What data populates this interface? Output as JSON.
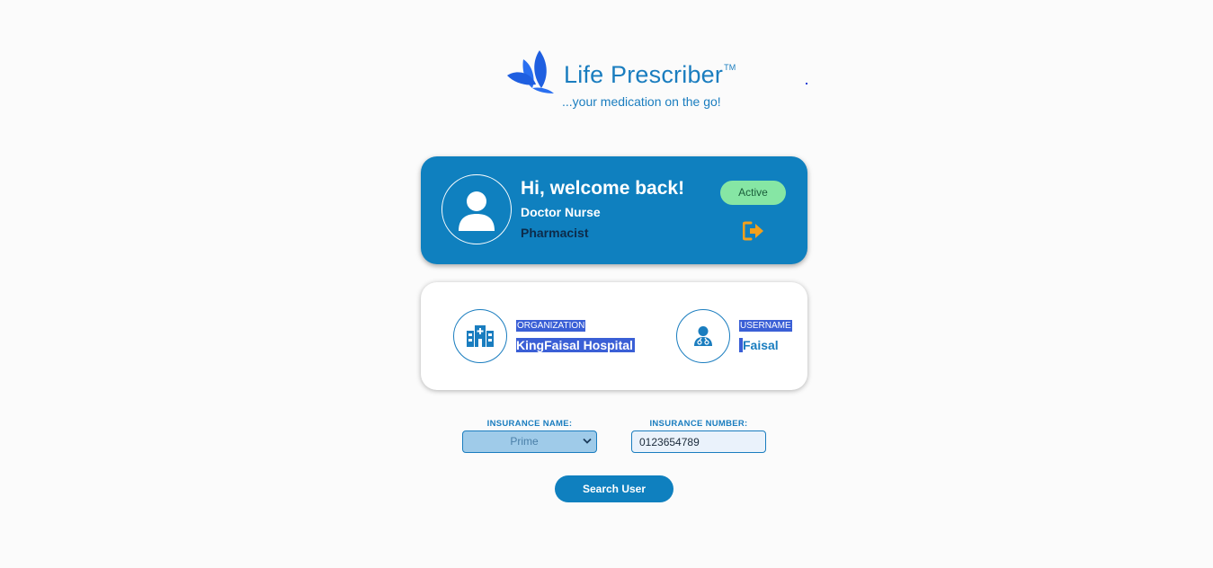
{
  "brand": {
    "name": "Life Prescriber",
    "trademark": "TM",
    "tagline": "...your medication on the go!",
    "color": "#1a7dbf",
    "logo_icon": "leaf-logo-icon"
  },
  "welcome": {
    "greeting": "Hi, welcome back!",
    "role_primary": "Doctor Nurse",
    "role_secondary": "Pharmacist",
    "status": "Active",
    "status_color": "#86e6a4",
    "avatar_icon": "user-icon",
    "logout_icon": "logout-icon",
    "card_color": "#0f80bf"
  },
  "info": {
    "organization": {
      "label": "ORGANIZATION",
      "value": "KingFaisal Hospital",
      "icon": "hospital-icon"
    },
    "username": {
      "label": "USERNAME",
      "value": "Faisal",
      "icon": "doctor-icon"
    },
    "highlight_color": "#3a5fd6"
  },
  "form": {
    "insurance_name_label": "INSURANCE NAME:",
    "insurance_name_value": "Prime",
    "insurance_number_label": "INSURANCE NUMBER:",
    "insurance_number_value": "0123654789",
    "search_button": "Search User"
  }
}
